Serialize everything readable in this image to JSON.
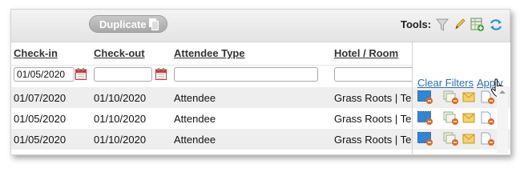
{
  "toolbar": {
    "duplicate_label": "Duplicate",
    "tools_label": "Tools:"
  },
  "columns": {
    "checkin": "Check-in",
    "checkout": "Check-out",
    "attendee_type": "Attendee Type",
    "hotel_room": "Hotel / Room"
  },
  "filters": {
    "checkin_value": "01/05/2020",
    "checkout_value": "",
    "attendee_type_value": "",
    "hotel_room_value": "",
    "clear_filters_label": "Clear Filters",
    "apply_label": "Apply"
  },
  "rows": [
    {
      "checkin": "01/07/2020",
      "checkout": "01/10/2020",
      "attendee_type": "Attendee",
      "hotel_room": "Grass Roots | Tes"
    },
    {
      "checkin": "01/05/2020",
      "checkout": "01/10/2020",
      "attendee_type": "Attendee",
      "hotel_room": "Grass Roots | Tes"
    },
    {
      "checkin": "01/05/2020",
      "checkout": "01/10/2020",
      "attendee_type": "Attendee",
      "hotel_room": "Grass Roots | Tes"
    }
  ],
  "colors": {
    "link": "#2a6db5",
    "row_alt": "#eeeeee",
    "duplicate_bg": "#b5b5b5"
  },
  "icons": {
    "duplicate": "copy-icon",
    "tools": [
      "filter-icon",
      "pencil-icon",
      "add-spreadsheet-icon",
      "refresh-icon"
    ],
    "row_actions": [
      "edit-screen-icon",
      "move-record-icon",
      "email-icon",
      "document-icon"
    ]
  }
}
